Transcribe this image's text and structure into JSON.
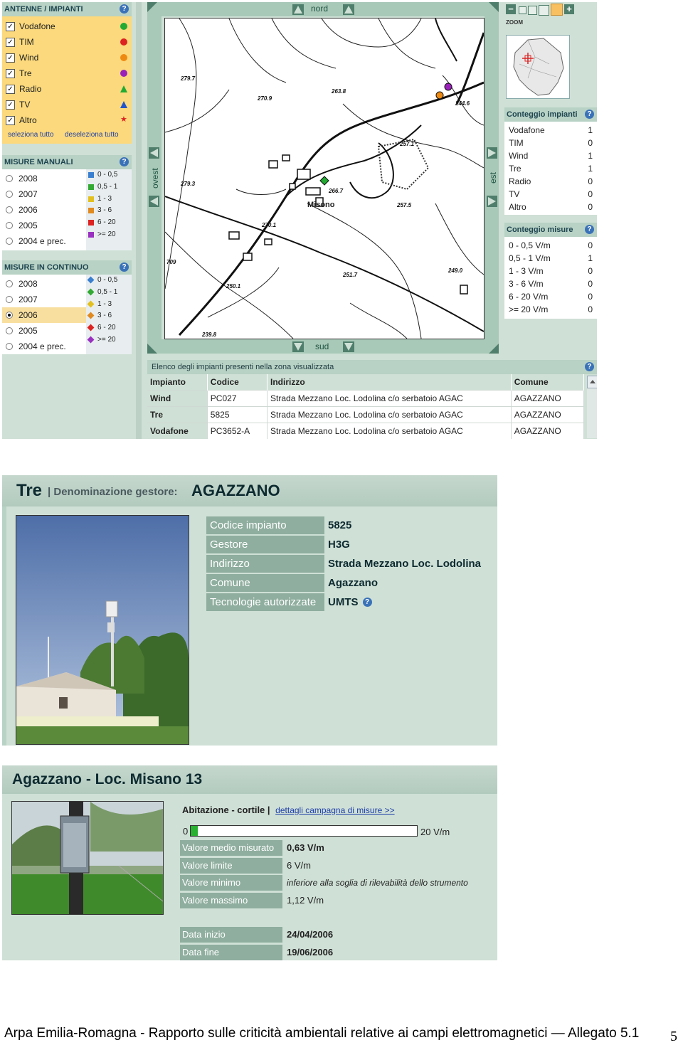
{
  "antenne": {
    "title": "ANTENNE / IMPIANTI",
    "help": "?",
    "items": [
      {
        "label": "Vodafone",
        "icon": "green-dot-icon",
        "color": "#22aa33"
      },
      {
        "label": "TIM",
        "icon": "red-dot-icon",
        "color": "#dd2222"
      },
      {
        "label": "Wind",
        "icon": "orange-dot-icon",
        "color": "#ee8a11"
      },
      {
        "label": "Tre",
        "icon": "purple-dot-icon",
        "color": "#9a22bb"
      },
      {
        "label": "Radio",
        "icon": "green-tower-icon",
        "color": "#22aa33"
      },
      {
        "label": "TV",
        "icon": "blue-tower-icon",
        "color": "#2255cc"
      },
      {
        "label": "Altro",
        "icon": "red-star-icon",
        "color": "#dd2222"
      }
    ],
    "select_all": "seleziona tutto",
    "deselect_all": "deseleziona tutto"
  },
  "misure_manuali": {
    "title": "MISURE MANUALI",
    "years": [
      "2008",
      "2007",
      "2006",
      "2005",
      "2004 e prec."
    ],
    "legend": [
      "0 - 0,5",
      "0,5 - 1",
      "1 - 3",
      "3 - 6",
      "6 - 20",
      ">= 20"
    ],
    "legend_colors": [
      "#3a7fd0",
      "#33aa33",
      "#e3c020",
      "#e08a20",
      "#dd2222",
      "#9a30c0"
    ]
  },
  "misure_continuo": {
    "title": "MISURE IN CONTINUO",
    "years": [
      "2008",
      "2007",
      "2006",
      "2005",
      "2004 e prec."
    ],
    "selected_year": "2006",
    "legend": [
      "0 - 0,5",
      "0,5 - 1",
      "1 - 3",
      "3 - 6",
      "6 - 20",
      ">= 20"
    ],
    "legend_colors": [
      "#3a7fd0",
      "#33aa33",
      "#e3c020",
      "#e08a20",
      "#dd2222",
      "#9a30c0"
    ]
  },
  "map": {
    "north": "nord",
    "south": "sud",
    "west": "ovest",
    "east": "est",
    "place_label": "Misono",
    "elevations": [
      "279.7",
      "270.9",
      "263.8",
      "244.6",
      "257.1",
      "279.3",
      "266.7",
      "257.5",
      "270.1",
      "251.7",
      "250.1",
      "249.0",
      "239.8",
      "709"
    ]
  },
  "zoom": {
    "label": "ZOOM"
  },
  "conteggio_impianti": {
    "title": "Conteggio impianti",
    "rows": [
      {
        "label": "Vodafone",
        "count": "1"
      },
      {
        "label": "TIM",
        "count": "0"
      },
      {
        "label": "Wind",
        "count": "1"
      },
      {
        "label": "Tre",
        "count": "1"
      },
      {
        "label": "Radio",
        "count": "0"
      },
      {
        "label": "TV",
        "count": "0"
      },
      {
        "label": "Altro",
        "count": "0"
      }
    ]
  },
  "conteggio_misure": {
    "title": "Conteggio misure",
    "rows": [
      {
        "label": "0 - 0,5 V/m",
        "count": "0"
      },
      {
        "label": "0,5 - 1 V/m",
        "count": "1"
      },
      {
        "label": "1 - 3 V/m",
        "count": "0"
      },
      {
        "label": "3 - 6 V/m",
        "count": "0"
      },
      {
        "label": "6 - 20 V/m",
        "count": "0"
      },
      {
        "label": ">= 20 V/m",
        "count": "0"
      }
    ]
  },
  "elenco": {
    "title": "Elenco degli impianti presenti nella zona visualizzata",
    "columns": [
      "Impianto",
      "Codice",
      "Indirizzo",
      "Comune"
    ],
    "rows": [
      [
        "Wind",
        "PC027",
        "Strada Mezzano Loc. Lodolina c/o serbatoio AGAC",
        "AGAZZANO"
      ],
      [
        "Tre",
        "5825",
        "Strada Mezzano Loc. Lodolina c/o serbatoio AGAC",
        "AGAZZANO"
      ],
      [
        "Vodafone",
        "PC3652-A",
        "Strada Mezzano Loc. Lodolina c/o serbatoio AGAC",
        "AGAZZANO"
      ]
    ]
  },
  "scheda_impianto": {
    "gestore_short": "Tre",
    "denominazione_label": "| Denominazione gestore:",
    "denominazione": "AGAZZANO",
    "rows": [
      {
        "k": "Codice impianto",
        "v": "5825"
      },
      {
        "k": "Gestore",
        "v": "H3G"
      },
      {
        "k": "Indirizzo",
        "v": "Strada Mezzano Loc. Lodolina"
      },
      {
        "k": "Comune",
        "v": "Agazzano"
      },
      {
        "k": "Tecnologie autorizzate",
        "v": "UMTS"
      }
    ]
  },
  "scheda_misura": {
    "title": "Agazzano - Loc. Misano 13",
    "location": "Abitazione - cortile |",
    "link": "dettagli campagna di misure >>",
    "scale_min": "0",
    "scale_max": "20 V/m",
    "level_fraction": 0.0315,
    "rows": [
      {
        "k": "Valore medio misurato",
        "v": "0,63 V/m"
      },
      {
        "k": "Valore limite",
        "v": "6 V/m"
      },
      {
        "k": "Valore minimo",
        "v": "inferiore alla soglia di rilevabilità dello strumento"
      },
      {
        "k": "Valore massimo",
        "v": "1,12 V/m"
      }
    ],
    "dates": [
      {
        "k": "Data inizio",
        "v": "24/04/2006"
      },
      {
        "k": "Data fine",
        "v": "19/06/2006"
      }
    ]
  },
  "footer": {
    "caption": "Arpa Emilia-Romagna - Rapporto sulle criticità ambientali relative ai campi elettromagnetici — Allegato 5.1",
    "page": "5"
  }
}
